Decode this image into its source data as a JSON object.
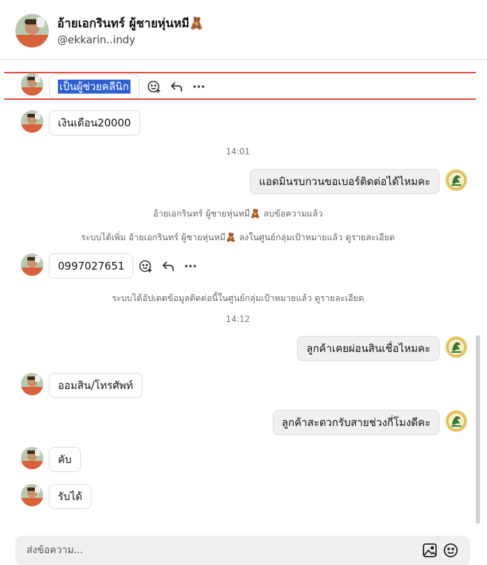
{
  "header": {
    "name": "อ้ายเอกรินทร์ ผู้ชายหุ่นหมี🧸",
    "handle": "@ekkarin..indy"
  },
  "messages": {
    "m1_selected": "เป็นผู้ช่วยคลีนิก",
    "m2": "เงินเดือน20000",
    "time1": "14:01",
    "m3_out": "แอดมินรบกวนขอเบอร์ติดต่อได้ไหมคะ",
    "sys1": "อ้ายเอกรินทร์ ผู้ชายหุ่นหมี🧸 ลบข้อความแล้ว",
    "sys2": "ระบบได้เพิ่ม อ้ายเอกรินทร์ ผู้ชายหุ่นหมี🧸 ลงในศูนย์กลุ่มเป้าหมายแล้ว ดูรายละเอียด",
    "m4": "0997027651",
    "sys3": "ระบบได้อัปเดตข้อมูลติดต่อนี้ในศูนย์กลุ่มเป้าหมายแล้ว ดูรายละเอียด",
    "time2": "14:12",
    "m5_out": "ลูกค้าเคยผ่อนสินเชื่อไหมคะ",
    "m6": "ออมสิน/โทรศัพท์",
    "m7_out": "ลูกค้าสะดวกรับสายช่วงกี่โมงดีคะ",
    "m8": "คับ",
    "m9": "รับได้"
  },
  "composer": {
    "placeholder": "ส่งข้อความ..."
  },
  "icons": {
    "react": "emoji-add-icon",
    "reply": "reply-icon",
    "more": "more-icon",
    "image": "image-icon",
    "emoji": "emoji-icon"
  },
  "colors": {
    "highlight_line": "#e0453a",
    "selection": "#2d5fd4",
    "outgoing_bubble": "#f0f0f0"
  }
}
